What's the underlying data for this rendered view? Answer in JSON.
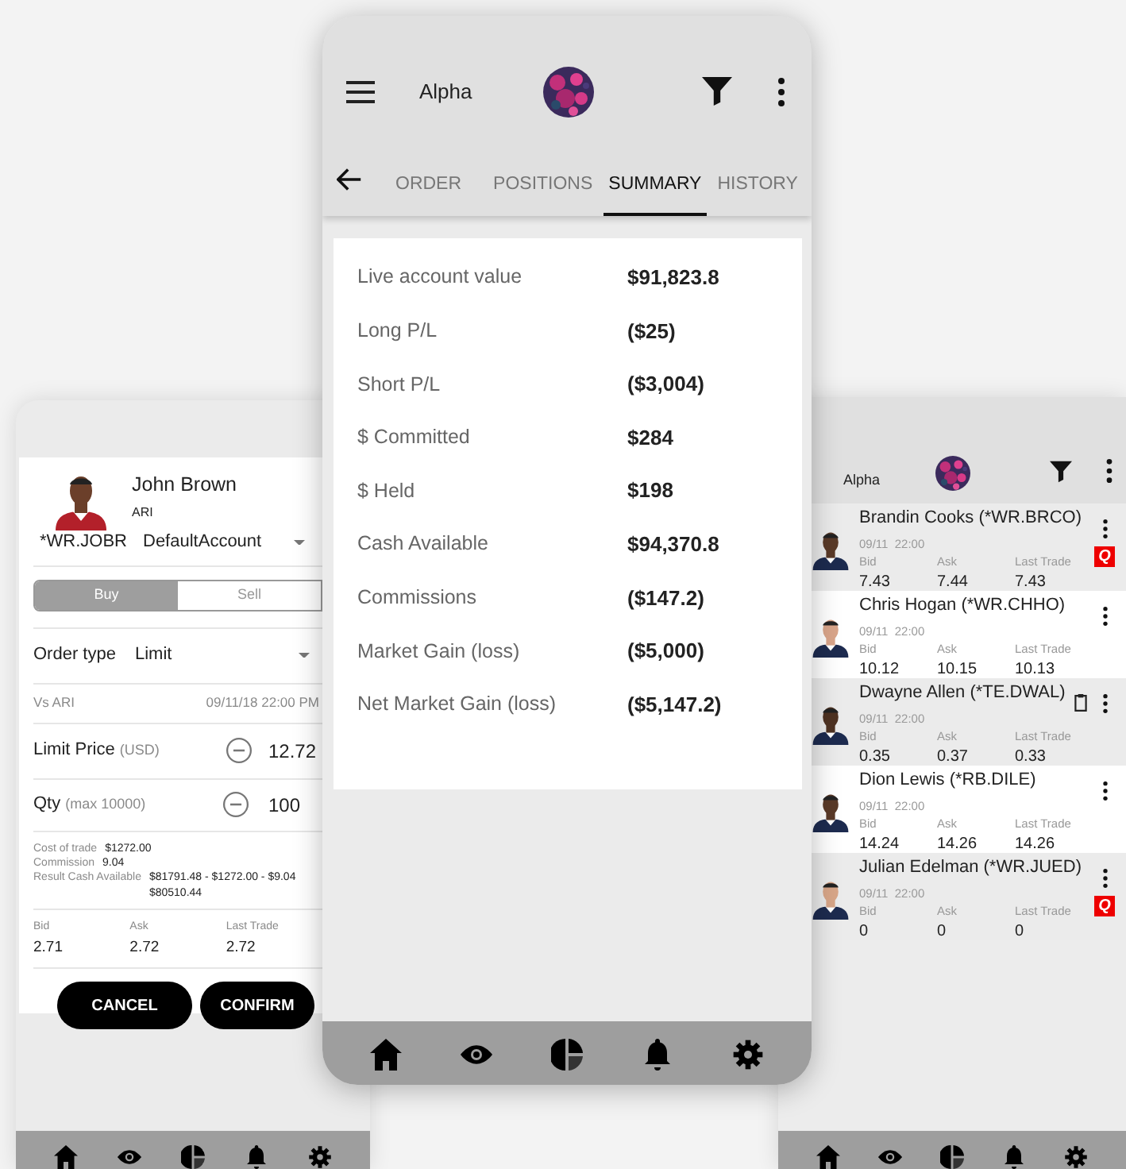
{
  "order_screen": {
    "player": {
      "name": "John Brown",
      "team": "ARI",
      "symbol": "*WR.JOBR"
    },
    "account": "DefaultAccount",
    "sides": [
      {
        "label": "Buy",
        "selected": true
      },
      {
        "label": "Sell",
        "selected": false
      }
    ],
    "order_type": {
      "label": "Order type",
      "value": "Limit"
    },
    "matchup": "Vs ARI",
    "game_time": "09/11/18 22:00 PM",
    "limit_price": {
      "label": "Limit Price",
      "unit": "(USD)",
      "value": "12.72"
    },
    "quantity": {
      "label": "Qty",
      "unit": "(max 10000)",
      "value": "100"
    },
    "costs": [
      {
        "label": "Cost of trade",
        "value": "$1272.00"
      },
      {
        "label": "Commission",
        "value": "9.04"
      },
      {
        "label": "Result Cash Available",
        "value": "$81791.48 - $1272.00 - $9.04",
        "value_2": "$80510.44"
      }
    ],
    "quote": [
      {
        "label": "Bid",
        "value": "2.71"
      },
      {
        "label": "Ask",
        "value": "2.72"
      },
      {
        "label": "Last Trade",
        "value": "2.72"
      }
    ],
    "buttons": [
      "CANCEL",
      "CONFIRM"
    ]
  },
  "summary_screen": {
    "title": "Alpha",
    "tabs": [
      {
        "label": "ORDER",
        "selected": false
      },
      {
        "label": "POSITIONS",
        "selected": false
      },
      {
        "label": "SUMMARY",
        "selected": true
      },
      {
        "label": "HISTORY",
        "selected": false
      }
    ],
    "rows": [
      {
        "label": "Live account value",
        "value": "$91,823.8"
      },
      {
        "label": "Long P/L",
        "value": "($25)"
      },
      {
        "label": "Short P/L",
        "value": "($3,004)"
      },
      {
        "label": "$ Committed",
        "value": "$284"
      },
      {
        "label": "$ Held",
        "value": "$198"
      },
      {
        "label": "Cash Available",
        "value": "$94,370.8"
      },
      {
        "label": "Commissions",
        "value": "($147.2)"
      },
      {
        "label": "Market Gain (loss)",
        "value": "($5,000)"
      },
      {
        "label": "Net Market Gain (loss)",
        "value": "($5,147.2)"
      }
    ]
  },
  "players_screen": {
    "title": "Alpha",
    "players": [
      {
        "name": "Brandin Cooks (*WR.BRCO)",
        "time": "09/11  22:00",
        "quote": [
          {
            "label": "Bid",
            "value": "7.43"
          },
          {
            "label": "Ask",
            "value": "7.44"
          },
          {
            "label": "Last Trade",
            "value": "7.43"
          }
        ],
        "indicator": {
          "kind": "quote",
          "text": "Q"
        }
      },
      {
        "name": "Chris Hogan (*WR.CHHO)",
        "time": "09/11  22:00",
        "quote": [
          {
            "label": "Bid",
            "value": "10.12"
          },
          {
            "label": "Ask",
            "value": "10.15"
          },
          {
            "label": "Last Trade",
            "value": "10.13"
          }
        ]
      },
      {
        "name": "Dwayne Allen (*TE.DWAL)",
        "time": "09/11  22:00",
        "quote": [
          {
            "label": "Bid",
            "value": "0.35"
          },
          {
            "label": "Ask",
            "value": "0.37"
          },
          {
            "label": "Last Trade",
            "value": "0.33"
          }
        ],
        "indicator": {
          "kind": "clipboard"
        }
      },
      {
        "name": "Dion Lewis (*RB.DILE)",
        "time": "09/11  22:00",
        "quote": [
          {
            "label": "Bid",
            "value": "14.24"
          },
          {
            "label": "Ask",
            "value": "14.26"
          },
          {
            "label": "Last Trade",
            "value": "14.26"
          }
        ]
      },
      {
        "name": "Julian Edelman (*WR.JUED)",
        "time": "09/11  22:00",
        "quote": [
          {
            "label": "Bid",
            "value": "0"
          },
          {
            "label": "Ask",
            "value": "0"
          },
          {
            "label": "Last Trade",
            "value": "0"
          }
        ],
        "indicator": {
          "kind": "quote",
          "text": "Q"
        }
      }
    ]
  }
}
